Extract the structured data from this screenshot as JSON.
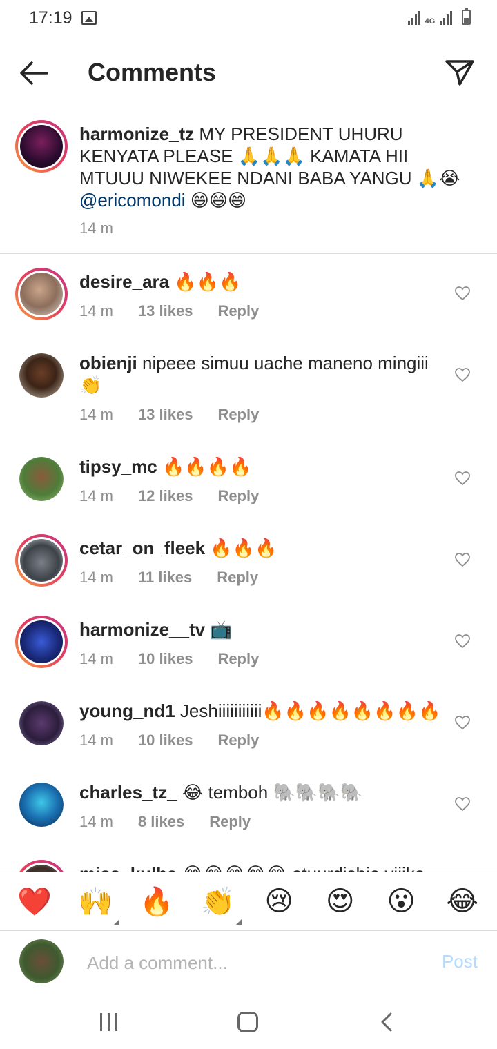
{
  "status_bar": {
    "time": "17:19",
    "network": "4G"
  },
  "header": {
    "title": "Comments"
  },
  "caption": {
    "username": "harmonize_tz",
    "text": "MY PRESIDENT UHURU KENYATA  PLEASE 🙏🙏🙏 KAMATA HII MTUUU NIWEKEE NDANI BABA YANGU 🙏😭",
    "mention": "@ericomondi",
    "trailing": "😄😄😄",
    "time": "14 m"
  },
  "comments": [
    {
      "username": "desire_ara",
      "text": "🔥🔥🔥",
      "time": "14 m",
      "likes": "13 likes",
      "reply": "Reply"
    },
    {
      "username": "obienji",
      "text": "nipeee simuu uache maneno mingiii 👏",
      "time": "14 m",
      "likes": "13 likes",
      "reply": "Reply"
    },
    {
      "username": "tipsy_mc",
      "text": "🔥🔥🔥🔥",
      "time": "14 m",
      "likes": "12 likes",
      "reply": "Reply"
    },
    {
      "username": "cetar_on_fleek",
      "text": "🔥🔥🔥",
      "time": "14 m",
      "likes": "11 likes",
      "reply": "Reply"
    },
    {
      "username": "harmonize__tv",
      "text": "📺",
      "time": "14 m",
      "likes": "10 likes",
      "reply": "Reply"
    },
    {
      "username": "young_nd1",
      "text": "Jeshiiiiiiiiiii🔥🔥🔥🔥🔥🔥🔥🔥",
      "time": "14 m",
      "likes": "10 likes",
      "reply": "Reply"
    },
    {
      "username": "charles_tz_",
      "text": "😂 temboh 🐘🐘🐘🐘",
      "time": "14 m",
      "likes": "8 likes",
      "reply": "Reply"
    },
    {
      "username": "miss_kulba",
      "text": "😂😂😂😂😂 atuurdishie viiiko",
      "time": "",
      "likes": "",
      "reply": ""
    }
  ],
  "emoji_bar": [
    "❤️",
    "🙌",
    "🔥",
    "👏",
    "😢",
    "😍",
    "😮",
    "😂"
  ],
  "composer": {
    "placeholder": "Add a comment...",
    "post_label": "Post"
  },
  "colors": {
    "accent": "#0095f6",
    "post_disabled": "#b3dbff",
    "ring_start": "#f9a13c",
    "ring_end": "#c13584",
    "muted": "#8e8e8e",
    "link": "#00376b"
  }
}
